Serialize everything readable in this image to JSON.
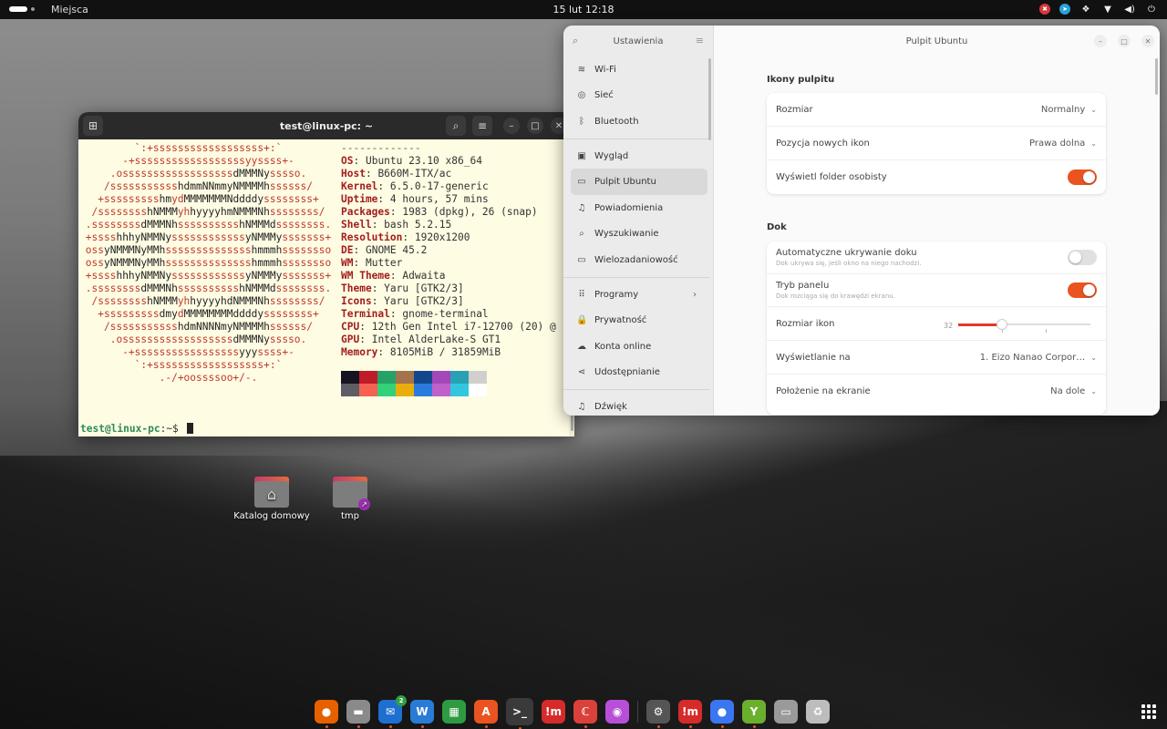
{
  "topbar": {
    "places_label": "Miejsca",
    "clock": "15 lut  12:18",
    "tray_icons": [
      "record-indicator-icon",
      "telegram-icon",
      "dropbox-icon",
      "wifi-icon",
      "volume-icon",
      "power-icon"
    ]
  },
  "terminal": {
    "title": "test@linux-pc: ~",
    "logo_lines": [
      [
        [
          "r",
          "`:+ssssssssssssssssss+:`"
        ]
      ],
      [
        [
          "r",
          "-+ssssssssssssssssssyyssss+-"
        ]
      ],
      [
        [
          "r",
          ".ossssssssssssssssss"
        ],
        [
          "b",
          "dMMMNy"
        ],
        [
          "r",
          "sssso."
        ]
      ],
      [
        [
          "r",
          "/sssssssssss"
        ],
        [
          "b",
          "hdmmNNmmyNMMMMh"
        ],
        [
          "r",
          "ssssss/"
        ]
      ],
      [
        [
          "r",
          "+sssssssss"
        ],
        [
          "b",
          "hm"
        ],
        [
          "r",
          "yd"
        ],
        [
          "b",
          "MMMMMMMNddddy"
        ],
        [
          "r",
          "ssssssss+"
        ]
      ],
      [
        [
          "r",
          "/ssssssss"
        ],
        [
          "b",
          "hNMMM"
        ],
        [
          "r",
          "yh"
        ],
        [
          "b",
          "hyyyyhmNMMMNh"
        ],
        [
          "r",
          "ssssssss/"
        ]
      ],
      [
        [
          "r",
          ".ssssssss"
        ],
        [
          "b",
          "dMMMNh"
        ],
        [
          "r",
          "ssssssssss"
        ],
        [
          "b",
          "hNMMMd"
        ],
        [
          "r",
          "ssssssss."
        ]
      ],
      [
        [
          "r",
          "+ssss"
        ],
        [
          "b",
          "hhhyNMMNy"
        ],
        [
          "r",
          "ssssssssssss"
        ],
        [
          "b",
          "yNMMMy"
        ],
        [
          "r",
          "sssssss+"
        ]
      ],
      [
        [
          "r",
          "oss"
        ],
        [
          "b",
          "yNMMMNyMMh"
        ],
        [
          "r",
          "ssssssssssssss"
        ],
        [
          "b",
          "hmmmh"
        ],
        [
          "r",
          "ssssssso"
        ]
      ],
      [
        [
          "r",
          "oss"
        ],
        [
          "b",
          "yNMMMNyMMh"
        ],
        [
          "r",
          "ssssssssssssss"
        ],
        [
          "b",
          "hmmmh"
        ],
        [
          "r",
          "ssssssso"
        ]
      ],
      [
        [
          "r",
          "+ssss"
        ],
        [
          "b",
          "hhhyNMMNy"
        ],
        [
          "r",
          "ssssssssssss"
        ],
        [
          "b",
          "yNMMMy"
        ],
        [
          "r",
          "sssssss+"
        ]
      ],
      [
        [
          "r",
          ".ssssssss"
        ],
        [
          "b",
          "dMMMNh"
        ],
        [
          "r",
          "ssssssssss"
        ],
        [
          "b",
          "hNMMMd"
        ],
        [
          "r",
          "ssssssss."
        ]
      ],
      [
        [
          "r",
          "/ssssssss"
        ],
        [
          "b",
          "hNMMM"
        ],
        [
          "r",
          "yh"
        ],
        [
          "b",
          "hyyyyhdNMMMNh"
        ],
        [
          "r",
          "ssssssss/"
        ]
      ],
      [
        [
          "r",
          "+sssssssss"
        ],
        [
          "b",
          "dmy"
        ],
        [
          "r",
          "d"
        ],
        [
          "b",
          "MMMMMMMMddddy"
        ],
        [
          "r",
          "ssssssss+"
        ]
      ],
      [
        [
          "r",
          "/sssssssssss"
        ],
        [
          "b",
          "hdmNNNNmyNMMMMh"
        ],
        [
          "r",
          "ssssss/"
        ]
      ],
      [
        [
          "r",
          ".ossssssssssssssssss"
        ],
        [
          "b",
          "dMMMNy"
        ],
        [
          "r",
          "sssso."
        ]
      ],
      [
        [
          "r",
          "-+sssssssssssssssss"
        ],
        [
          "b",
          "yyy"
        ],
        [
          "r",
          "ssss+-"
        ]
      ],
      [
        [
          "r",
          "`:+ssssssssssssssssss+:`"
        ]
      ],
      [
        [
          "r",
          ".-/+oossssoo+/-."
        ]
      ]
    ],
    "separator": "-------------",
    "info": [
      {
        "key": "OS",
        "value": "Ubuntu 23.10 x86_64"
      },
      {
        "key": "Host",
        "value": "B660M-ITX/ac"
      },
      {
        "key": "Kernel",
        "value": "6.5.0-17-generic"
      },
      {
        "key": "Uptime",
        "value": "4 hours, 57 mins"
      },
      {
        "key": "Packages",
        "value": "1983 (dpkg), 26 (snap)"
      },
      {
        "key": "Shell",
        "value": "bash 5.2.15"
      },
      {
        "key": "Resolution",
        "value": "1920x1200"
      },
      {
        "key": "DE",
        "value": "GNOME 45.2"
      },
      {
        "key": "WM",
        "value": "Mutter"
      },
      {
        "key": "WM Theme",
        "value": "Adwaita"
      },
      {
        "key": "Theme",
        "value": "Yaru [GTK2/3]"
      },
      {
        "key": "Icons",
        "value": "Yaru [GTK2/3]"
      },
      {
        "key": "Terminal",
        "value": "gnome-terminal"
      },
      {
        "key": "CPU",
        "value": "12th Gen Intel i7-12700 (20) @"
      },
      {
        "key": "GPU",
        "value": "Intel AlderLake-S GT1"
      },
      {
        "key": "Memory",
        "value": "8105MiB / 31859MiB"
      }
    ],
    "palette": [
      "#171421",
      "#c01c28",
      "#26a269",
      "#a2734c",
      "#12488b",
      "#a347ba",
      "#2aa1b3",
      "#d0cfcc",
      "#5e5c64",
      "#f66151",
      "#33d17a",
      "#e9ad0c",
      "#2a7bde",
      "#c061cb",
      "#33c7de",
      "#ffffff"
    ],
    "prompt_user": "test@linux-pc",
    "prompt_path": ":~$"
  },
  "settings": {
    "sidebar_title": "Ustawienia",
    "content_title": "Pulpit Ubuntu",
    "sidebar_groups": [
      [
        {
          "label": "Wi-Fi",
          "icon": "wifi-icon",
          "glyph": "≋"
        },
        {
          "label": "Sieć",
          "icon": "network-icon",
          "glyph": "◎"
        },
        {
          "label": "Bluetooth",
          "icon": "bluetooth-icon",
          "glyph": "ᛒ"
        }
      ],
      [
        {
          "label": "Wygląd",
          "icon": "appearance-icon",
          "glyph": "▣"
        },
        {
          "label": "Pulpit Ubuntu",
          "icon": "desktop-icon",
          "glyph": "▭",
          "active": true
        },
        {
          "label": "Powiadomienia",
          "icon": "bell-icon",
          "glyph": "♫"
        },
        {
          "label": "Wyszukiwanie",
          "icon": "search-icon",
          "glyph": "⌕"
        },
        {
          "label": "Wielozadaniowość",
          "icon": "multitasking-icon",
          "glyph": "▭"
        }
      ],
      [
        {
          "label": "Programy",
          "icon": "apps-icon",
          "glyph": "⠿",
          "chevron": "›"
        },
        {
          "label": "Prywatność",
          "icon": "lock-icon",
          "glyph": "🔒"
        },
        {
          "label": "Konta online",
          "icon": "cloud-icon",
          "glyph": "☁"
        },
        {
          "label": "Udostępnianie",
          "icon": "share-icon",
          "glyph": "⋖"
        }
      ],
      [
        {
          "label": "Dźwięk",
          "icon": "music-note-icon",
          "glyph": "♫"
        }
      ]
    ],
    "desktop_icons_section": {
      "title": "Ikony pulpitu",
      "size_label": "Rozmiar",
      "size_value": "Normalny",
      "position_label": "Pozycja nowych ikon",
      "position_value": "Prawa dolna",
      "show_home_label": "Wyświetl folder osobisty",
      "show_home_on": true
    },
    "dock_section": {
      "title": "Dok",
      "autohide_label": "Automatyczne ukrywanie doku",
      "autohide_sub": "Dok ukrywa się, jeśli okno na niego nachodzi.",
      "autohide_on": false,
      "panel_label": "Tryb panelu",
      "panel_sub": "Dok rozciąga się do krawędzi ekranu.",
      "panel_on": true,
      "icon_size_label": "Rozmiar ikon",
      "icon_size_value": "32",
      "icon_size_fraction": 0.33,
      "display_label": "Wyświetlanie na",
      "display_value": "1. Eizo Nanao Corpor…",
      "position_label": "Położenie na ekranie",
      "position_value": "Na dole"
    }
  },
  "desktop": {
    "icons": [
      {
        "label": "Katalog domowy",
        "icon": "home-folder-icon"
      },
      {
        "label": "tmp",
        "icon": "folder-link-icon"
      }
    ]
  },
  "dock": {
    "apps": [
      {
        "name": "firefox",
        "icon": "firefox-icon",
        "glyph": "●",
        "color": "#e66000",
        "running": true
      },
      {
        "name": "files",
        "icon": "files-icon",
        "glyph": "▬",
        "color": "#8a8a8a",
        "running": true
      },
      {
        "name": "thunderbird",
        "icon": "thunderbird-icon",
        "glyph": "✉",
        "color": "#1f6fd0",
        "running": true,
        "badge": "2"
      },
      {
        "name": "libreoffice-writer",
        "icon": "writer-icon",
        "glyph": "W",
        "color": "#2a7bd6",
        "running": true
      },
      {
        "name": "libreoffice-calc",
        "icon": "calc-icon",
        "glyph": "▦",
        "color": "#2e9b42",
        "running": false
      },
      {
        "name": "app-center",
        "icon": "app-center-icon",
        "glyph": "A",
        "color": "#e95420",
        "running": true
      },
      {
        "name": "terminal",
        "icon": "terminal-icon",
        "glyph": ">_",
        "color": "#2c2c2c",
        "running": true,
        "active": true
      },
      {
        "name": "mpd-app",
        "icon": "mpd-icon",
        "glyph": "!m",
        "color": "#d62b2b",
        "running": false
      },
      {
        "name": "gradle-red",
        "icon": "red-app-icon",
        "glyph": "ℂ",
        "color": "#d9413a",
        "running": true
      },
      {
        "name": "color-picker",
        "icon": "color-wheel-icon",
        "glyph": "◉",
        "color": "#b84fd8",
        "running": false
      },
      {
        "sep": true
      },
      {
        "name": "settings",
        "icon": "settings-gear-icon",
        "glyph": "⚙",
        "color": "#555",
        "running": true
      },
      {
        "name": "mpd-app-2",
        "icon": "mpd-icon",
        "glyph": "!m",
        "color": "#d62b2b",
        "running": true
      },
      {
        "name": "signal",
        "icon": "blue-circle-app-icon",
        "glyph": "●",
        "color": "#3a76f0",
        "running": true
      },
      {
        "name": "keepass",
        "icon": "green-key-icon",
        "glyph": "Y",
        "color": "#6ab02c",
        "running": true
      },
      {
        "name": "disk",
        "icon": "drive-icon",
        "glyph": "▭",
        "color": "#9a9a9a",
        "running": false
      },
      {
        "name": "trash",
        "icon": "trash-icon",
        "glyph": "♻",
        "color": "#bdbdbd",
        "running": false
      }
    ]
  }
}
